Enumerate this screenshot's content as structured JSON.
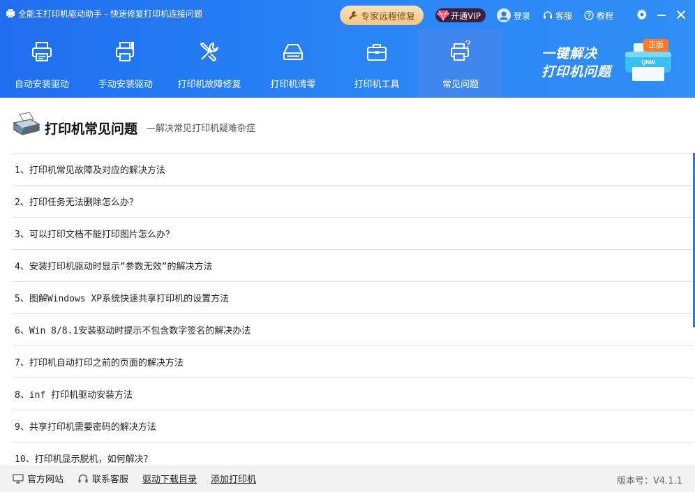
{
  "window": {
    "title": "全能王打印机驱动助手 - 快速修复打印机连接问题"
  },
  "titlebar": {
    "expert_label": "专家远程修复",
    "vip_label": "开通VIP",
    "login_label": "登录",
    "service_label": "客服",
    "tutorial_label": "教程"
  },
  "nav": [
    {
      "label": "自动安装驱动",
      "icon": "printer-icon"
    },
    {
      "label": "手动安装驱动",
      "icon": "printer-hand-icon"
    },
    {
      "label": "打印机故障修复",
      "icon": "wrench-screwdriver-icon"
    },
    {
      "label": "打印机清零",
      "icon": "scanner-icon"
    },
    {
      "label": "打印机工具",
      "icon": "toolbox-icon"
    },
    {
      "label": "常见问题",
      "icon": "printer-question-icon",
      "active": true
    }
  ],
  "promo": {
    "line1": "一键解决",
    "line2": "打印机问题",
    "badge": "正版",
    "brand": "QNW"
  },
  "section": {
    "title": "打印机常见问题",
    "subtitle": "—解决常见打印机疑难杂症"
  },
  "faq": [
    "1、打印机常见故障及对应的解决方法",
    "2、打印任务无法删除怎么办？",
    "3、可以打印文档不能打印图片怎么办？",
    "4、安装打印机驱动时显示”参数无效”的解决方法",
    "5、图解Windows XP系统快速共享打印机的设置方法",
    "6、Win 8/8.1安装驱动时提示不包含数字签名的解决办法",
    "7、打印机自动打印之前的页面的解决方法",
    "8、inf 打印机驱动安装方法",
    "9、共享打印机需要密码的解决方法",
    "10、打印机显示脱机，如何解决？"
  ],
  "footer": {
    "website_label": "官方网站",
    "service_label": "联系客服",
    "download_label": "驱动下载目录",
    "add_printer_label": "添加打印机",
    "version": "版本号：V4.1.1"
  },
  "colors": {
    "header": "#2a86f5",
    "active_tab": "#3f86ee",
    "accent": "#2a78e6",
    "promo_badge": "#ff7a26"
  }
}
